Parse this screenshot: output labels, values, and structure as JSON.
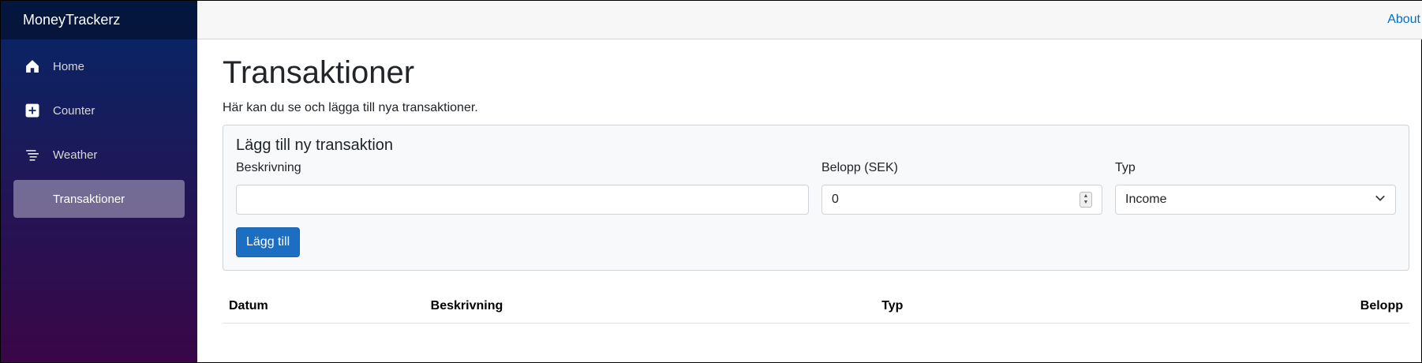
{
  "sidebar": {
    "brand": "MoneyTrackerz",
    "items": [
      {
        "label": "Home",
        "icon": "home-icon"
      },
      {
        "label": "Counter",
        "icon": "plus-square-icon"
      },
      {
        "label": "Weather",
        "icon": "list-icon"
      },
      {
        "label": "Transaktioner",
        "icon": "none"
      }
    ],
    "active_index": 3
  },
  "top": {
    "about_label": "About"
  },
  "page": {
    "title": "Transaktioner",
    "description": "Här kan du se och lägga till nya transaktioner."
  },
  "form": {
    "title": "Lägg till ny transaktion",
    "description_label": "Beskrivning",
    "description_value": "",
    "amount_label": "Belopp (SEK)",
    "amount_value": "0",
    "type_label": "Typ",
    "type_value": "Income",
    "submit_label": "Lägg till"
  },
  "table": {
    "columns": [
      "Datum",
      "Beskrivning",
      "Typ",
      "Belopp"
    ],
    "rows": []
  },
  "colors": {
    "sidebar_top": "#052767",
    "sidebar_bottom": "#3a0647",
    "primary": "#1b6ec2",
    "link": "#0071c1"
  }
}
